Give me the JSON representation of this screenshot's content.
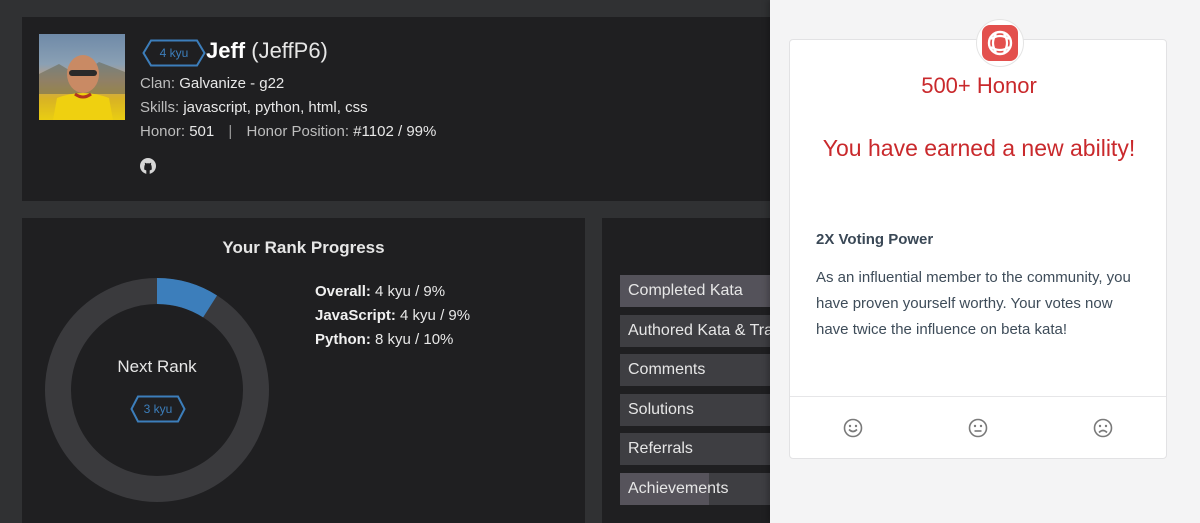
{
  "profile": {
    "rank": "4 kyu",
    "name": "Jeff",
    "username": "(JeffP6)",
    "clan_label": "Clan:",
    "clan": "Galvanize - g22",
    "skills_label": "Skills:",
    "skills": "javascript, python, html, css",
    "honor_label": "Honor:",
    "honor": "501",
    "separator": "|",
    "honor_position_label": "Honor Position:",
    "honor_position": "#1102 / 99%",
    "icons": [
      "avatar",
      "github-icon"
    ]
  },
  "rank_progress": {
    "title": "Your Rank Progress",
    "next_rank_label": "Next Rank",
    "next_rank": "3 kyu",
    "progress": 0.09,
    "colors": {
      "track": "#3a3a3d",
      "fill": "#3c7ebb"
    },
    "stats": [
      {
        "label": "Overall:",
        "value": "4 kyu / 9%"
      },
      {
        "label": "JavaScript:",
        "value": "4 kyu / 9%"
      },
      {
        "label": "Python:",
        "value": "8 kyu / 10%"
      }
    ]
  },
  "stats": {
    "items": [
      {
        "label": "Completed Kata"
      },
      {
        "label": "Authored Kata & Translations"
      },
      {
        "label": "Comments"
      },
      {
        "label": "Solutions"
      },
      {
        "label": "Referrals"
      },
      {
        "label": "Achievements",
        "fill": 0.55
      }
    ]
  },
  "notification": {
    "title": "500+ Honor",
    "message": "You have earned a new ability!",
    "ability": "2X Voting Power",
    "description": "As an influential member to the community, you have proven yourself worthy. Your votes now have twice the influence on beta kata!",
    "colors": {
      "accent": "#c9292c",
      "logo": "#e3504d"
    },
    "icons": [
      "codewars-logo-icon",
      "smile-icon",
      "neutral-face-icon",
      "sad-face-icon"
    ]
  }
}
